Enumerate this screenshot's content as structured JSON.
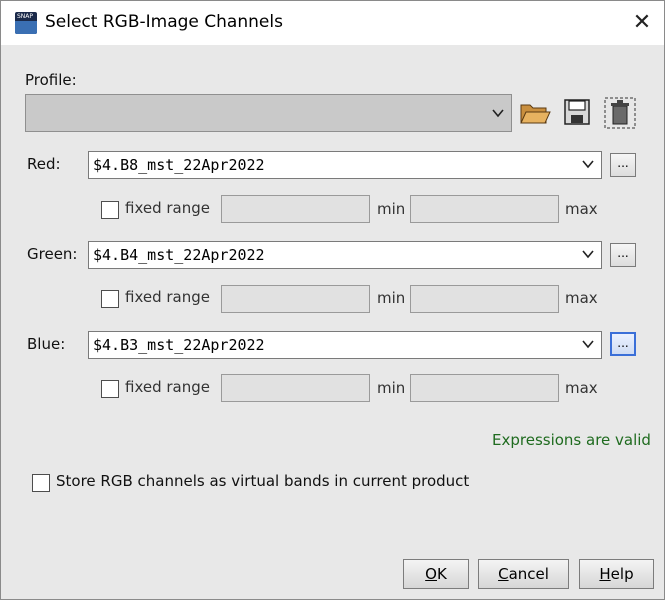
{
  "window": {
    "title": "Select RGB-Image Channels",
    "app_icon_text": "SNAP"
  },
  "profile": {
    "label": "Profile:",
    "value": ""
  },
  "channels": [
    {
      "label": "Red:",
      "expression": "$4.B8_mst_22Apr2022",
      "fixed_range_label": "fixed range",
      "min_label": "min",
      "max_label": "max",
      "min_value": "",
      "max_value": ""
    },
    {
      "label": "Green:",
      "expression": "$4.B4_mst_22Apr2022",
      "fixed_range_label": "fixed range",
      "min_label": "min",
      "max_label": "max",
      "min_value": "",
      "max_value": ""
    },
    {
      "label": "Blue:",
      "expression": "$4.B3_mst_22Apr2022",
      "fixed_range_label": "fixed range",
      "min_label": "min",
      "max_label": "max",
      "min_value": "",
      "max_value": ""
    }
  ],
  "ellipsis_label": "...",
  "status": {
    "text": "Expressions are valid",
    "color": "#1f6b1f"
  },
  "store_option": {
    "label": "Store RGB channels as virtual bands in current product"
  },
  "buttons": {
    "ok_first": "O",
    "ok_rest": "K",
    "cancel_first": "C",
    "cancel_rest": "ancel",
    "help_first": "H",
    "help_rest": "elp"
  },
  "accent_color": "#3a6fd8"
}
